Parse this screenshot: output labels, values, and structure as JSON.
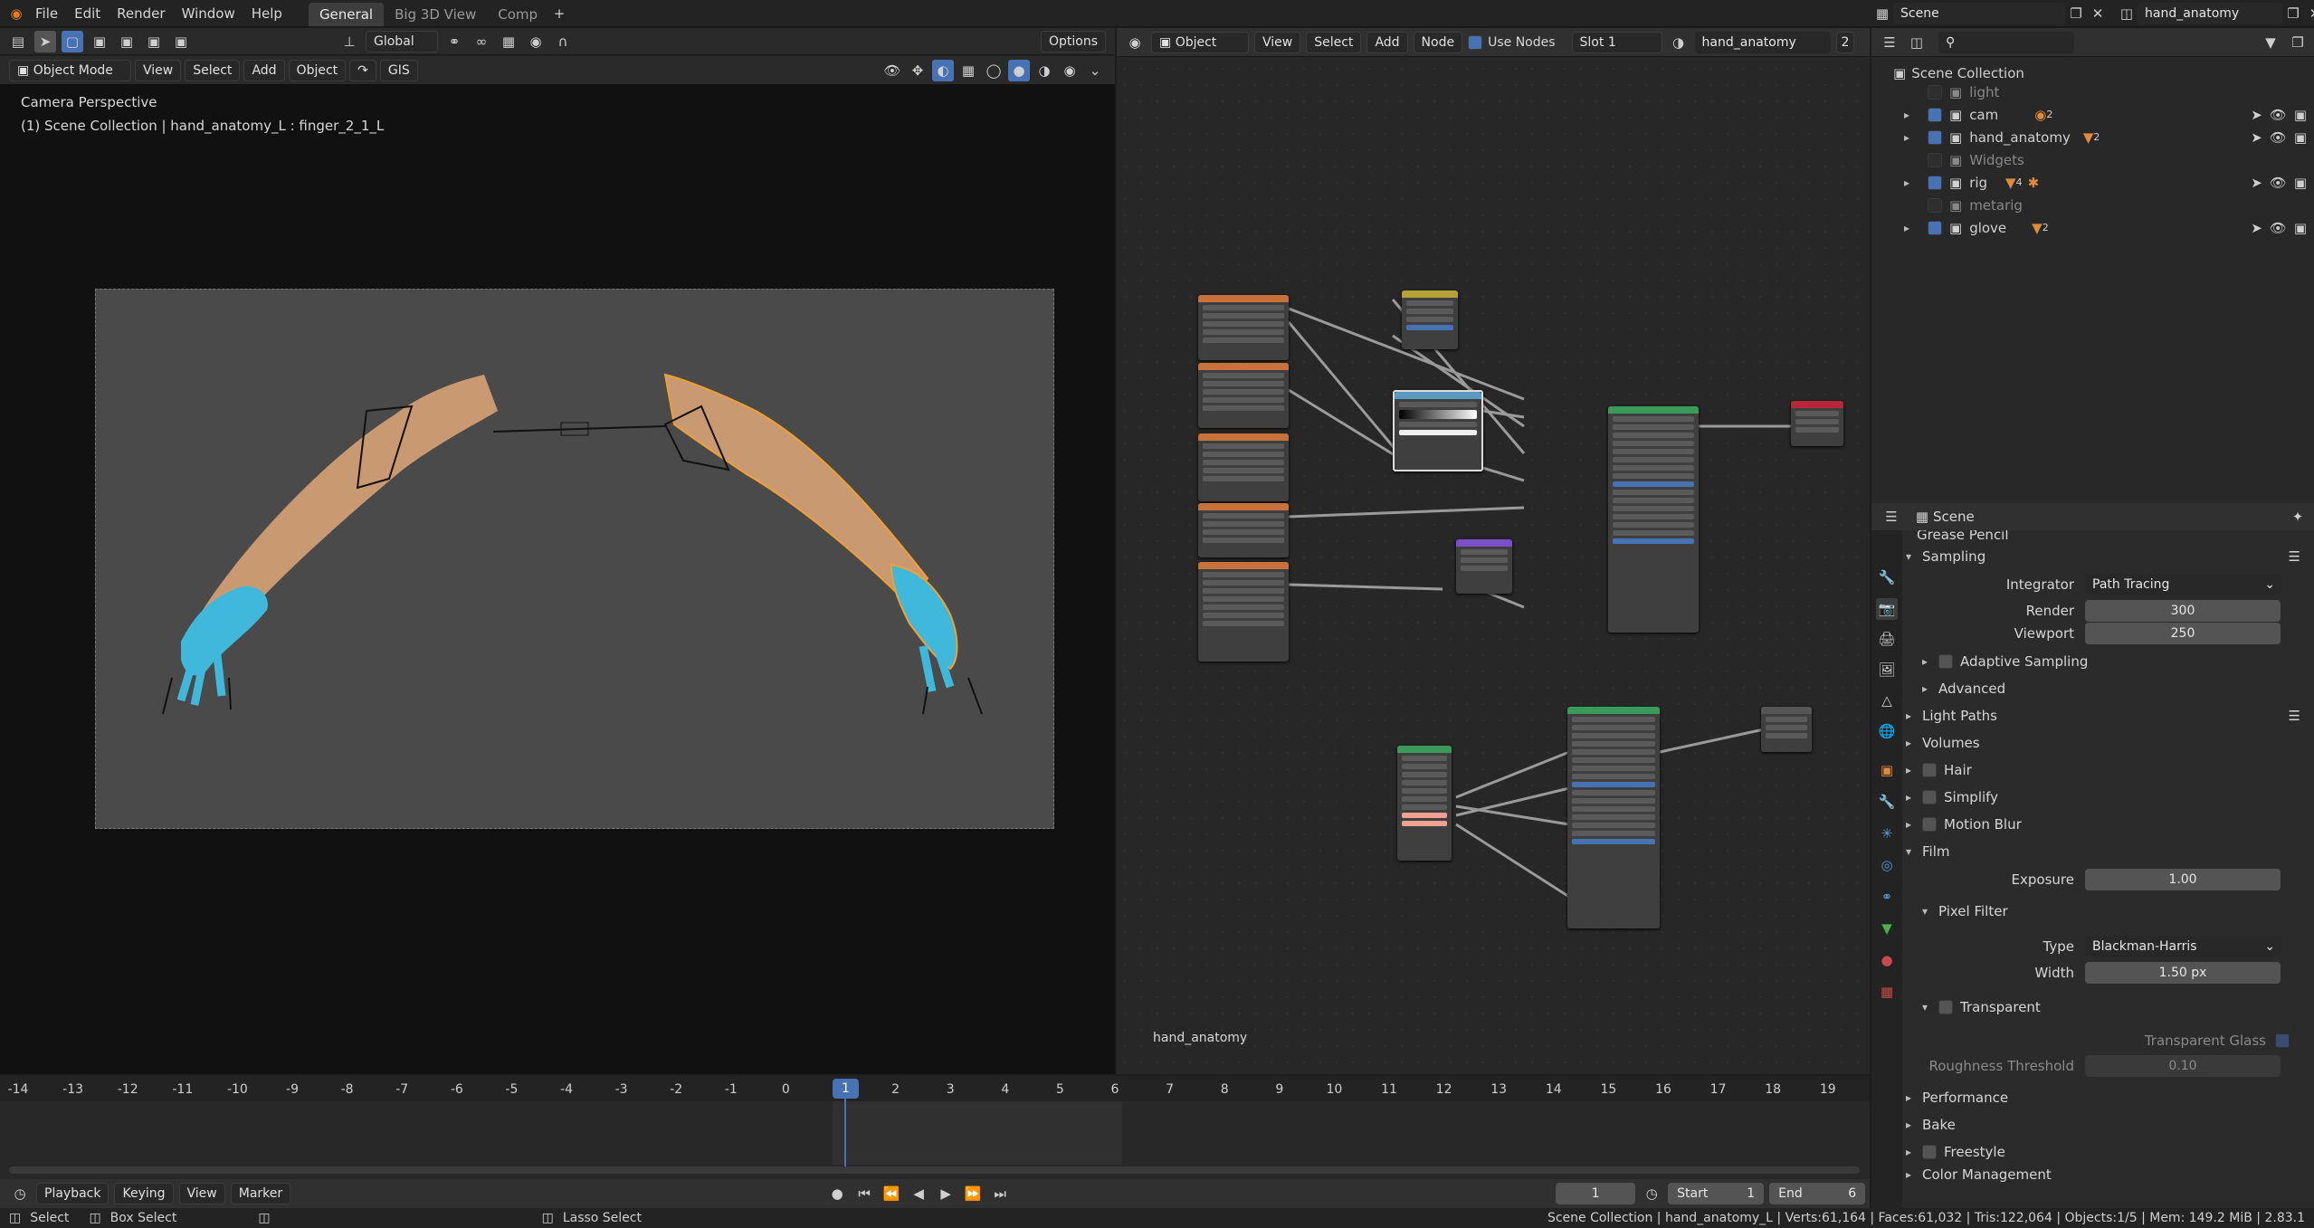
{
  "topbar": {
    "menus": [
      "File",
      "Edit",
      "Render",
      "Window",
      "Help"
    ],
    "workspaces": [
      "General",
      "Big 3D View",
      "Comp"
    ],
    "active_workspace": "General",
    "scene": "Scene",
    "view_layer": "hand_anatomy"
  },
  "viewport": {
    "mode": "Object Mode",
    "menus": [
      "View",
      "Select",
      "Add",
      "Object"
    ],
    "gis": "GIS",
    "orientation": "Global",
    "options": "Options",
    "overlay_title": "Camera Perspective",
    "overlay_info": "(1) Scene Collection | hand_anatomy_L : finger_2_1_L"
  },
  "node_editor": {
    "type": "Object",
    "menus": [
      "View",
      "Select",
      "Add",
      "Node"
    ],
    "use_nodes": "Use Nodes",
    "slot": "Slot 1",
    "material": "hand_anatomy",
    "users": "2",
    "footer_label": "hand_anatomy"
  },
  "outliner": {
    "root": "Scene Collection",
    "items": [
      {
        "name": "light",
        "enabled": false,
        "expandable": false
      },
      {
        "name": "cam",
        "enabled": true,
        "expandable": true,
        "badge": "2"
      },
      {
        "name": "hand_anatomy",
        "enabled": true,
        "expandable": true,
        "badge": "2"
      },
      {
        "name": "Widgets",
        "enabled": false,
        "expandable": false
      },
      {
        "name": "rig",
        "enabled": true,
        "expandable": true,
        "badge": "4"
      },
      {
        "name": "metarig",
        "enabled": false,
        "expandable": false
      },
      {
        "name": "glove",
        "enabled": true,
        "expandable": true,
        "badge": "2"
      }
    ]
  },
  "properties": {
    "context": "Scene",
    "cut_off_top": "Grease Pencil",
    "sampling": "Sampling",
    "integrator_label": "Integrator",
    "integrator": "Path Tracing",
    "render_label": "Render",
    "render_value": "300",
    "viewport_label": "Viewport",
    "viewport_value": "250",
    "adaptive": "Adaptive Sampling",
    "advanced": "Advanced",
    "light_paths": "Light Paths",
    "volumes": "Volumes",
    "hair": "Hair",
    "simplify": "Simplify",
    "motion_blur": "Motion Blur",
    "film": "Film",
    "exposure_label": "Exposure",
    "exposure_value": "1.00",
    "pixel_filter": "Pixel Filter",
    "type_label": "Type",
    "type_value": "Blackman-Harris",
    "width_label": "Width",
    "width_value": "1.50 px",
    "transparent": "Transparent",
    "transparent_glass": "Transparent Glass",
    "roughness_label": "Roughness Threshold",
    "roughness_value": "0.10",
    "performance": "Performance",
    "bake": "Bake",
    "freestyle": "Freestyle",
    "color_management": "Color Management"
  },
  "timeline": {
    "ticks": [
      "-14",
      "-13",
      "-12",
      "-11",
      "-10",
      "-9",
      "-8",
      "-7",
      "-6",
      "-5",
      "-4",
      "-3",
      "-2",
      "-1",
      "0",
      "1",
      "2",
      "3",
      "4",
      "5",
      "6",
      "7",
      "8",
      "9",
      "10",
      "11",
      "12",
      "13",
      "14",
      "15",
      "16",
      "17",
      "18",
      "19"
    ],
    "current_frame": "1",
    "menus": [
      "Playback",
      "Keying",
      "View",
      "Marker"
    ],
    "frame_field": "1",
    "start_label": "Start",
    "start_value": "1",
    "end_label": "End",
    "end_value": "6"
  },
  "statusbar": {
    "select": "Select",
    "box_select": "Box Select",
    "lasso_select": "Lasso Select",
    "stats": "Scene Collection | hand_anatomy_L | Verts:61,164 | Faces:61,032 | Tris:122,064 | Objects:1/5 | Mem: 149.2 MiB | 2.83.1"
  },
  "colors": {
    "accent": "#4772b3",
    "skin": "#c99a72",
    "glove": "#3fb8dc",
    "selection": "#f0a030"
  }
}
